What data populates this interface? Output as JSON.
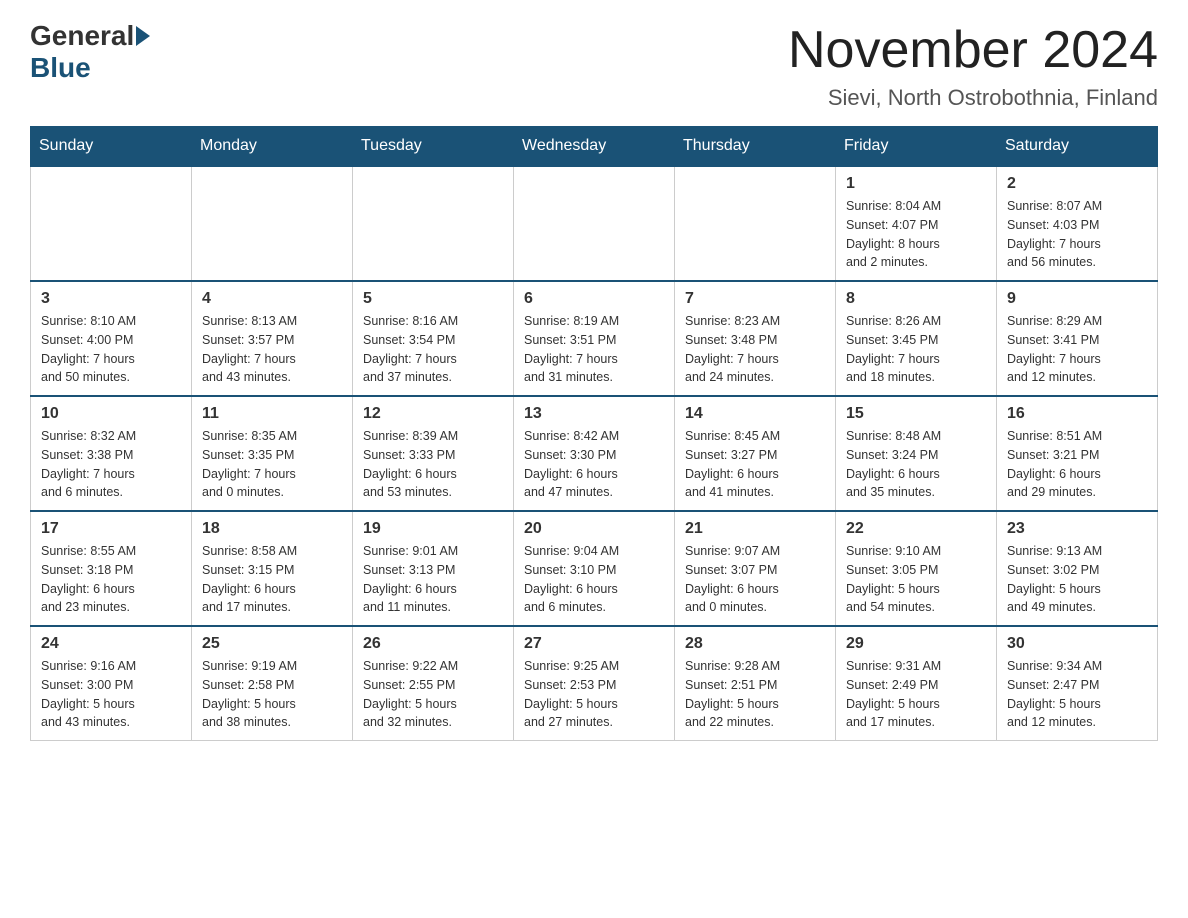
{
  "header": {
    "logo": {
      "general": "General",
      "blue": "Blue"
    },
    "title": "November 2024",
    "location": "Sievi, North Ostrobothnia, Finland"
  },
  "calendar": {
    "days_of_week": [
      "Sunday",
      "Monday",
      "Tuesday",
      "Wednesday",
      "Thursday",
      "Friday",
      "Saturday"
    ],
    "weeks": [
      [
        {
          "day": "",
          "info": ""
        },
        {
          "day": "",
          "info": ""
        },
        {
          "day": "",
          "info": ""
        },
        {
          "day": "",
          "info": ""
        },
        {
          "day": "",
          "info": ""
        },
        {
          "day": "1",
          "info": "Sunrise: 8:04 AM\nSunset: 4:07 PM\nDaylight: 8 hours\nand 2 minutes."
        },
        {
          "day": "2",
          "info": "Sunrise: 8:07 AM\nSunset: 4:03 PM\nDaylight: 7 hours\nand 56 minutes."
        }
      ],
      [
        {
          "day": "3",
          "info": "Sunrise: 8:10 AM\nSunset: 4:00 PM\nDaylight: 7 hours\nand 50 minutes."
        },
        {
          "day": "4",
          "info": "Sunrise: 8:13 AM\nSunset: 3:57 PM\nDaylight: 7 hours\nand 43 minutes."
        },
        {
          "day": "5",
          "info": "Sunrise: 8:16 AM\nSunset: 3:54 PM\nDaylight: 7 hours\nand 37 minutes."
        },
        {
          "day": "6",
          "info": "Sunrise: 8:19 AM\nSunset: 3:51 PM\nDaylight: 7 hours\nand 31 minutes."
        },
        {
          "day": "7",
          "info": "Sunrise: 8:23 AM\nSunset: 3:48 PM\nDaylight: 7 hours\nand 24 minutes."
        },
        {
          "day": "8",
          "info": "Sunrise: 8:26 AM\nSunset: 3:45 PM\nDaylight: 7 hours\nand 18 minutes."
        },
        {
          "day": "9",
          "info": "Sunrise: 8:29 AM\nSunset: 3:41 PM\nDaylight: 7 hours\nand 12 minutes."
        }
      ],
      [
        {
          "day": "10",
          "info": "Sunrise: 8:32 AM\nSunset: 3:38 PM\nDaylight: 7 hours\nand 6 minutes."
        },
        {
          "day": "11",
          "info": "Sunrise: 8:35 AM\nSunset: 3:35 PM\nDaylight: 7 hours\nand 0 minutes."
        },
        {
          "day": "12",
          "info": "Sunrise: 8:39 AM\nSunset: 3:33 PM\nDaylight: 6 hours\nand 53 minutes."
        },
        {
          "day": "13",
          "info": "Sunrise: 8:42 AM\nSunset: 3:30 PM\nDaylight: 6 hours\nand 47 minutes."
        },
        {
          "day": "14",
          "info": "Sunrise: 8:45 AM\nSunset: 3:27 PM\nDaylight: 6 hours\nand 41 minutes."
        },
        {
          "day": "15",
          "info": "Sunrise: 8:48 AM\nSunset: 3:24 PM\nDaylight: 6 hours\nand 35 minutes."
        },
        {
          "day": "16",
          "info": "Sunrise: 8:51 AM\nSunset: 3:21 PM\nDaylight: 6 hours\nand 29 minutes."
        }
      ],
      [
        {
          "day": "17",
          "info": "Sunrise: 8:55 AM\nSunset: 3:18 PM\nDaylight: 6 hours\nand 23 minutes."
        },
        {
          "day": "18",
          "info": "Sunrise: 8:58 AM\nSunset: 3:15 PM\nDaylight: 6 hours\nand 17 minutes."
        },
        {
          "day": "19",
          "info": "Sunrise: 9:01 AM\nSunset: 3:13 PM\nDaylight: 6 hours\nand 11 minutes."
        },
        {
          "day": "20",
          "info": "Sunrise: 9:04 AM\nSunset: 3:10 PM\nDaylight: 6 hours\nand 6 minutes."
        },
        {
          "day": "21",
          "info": "Sunrise: 9:07 AM\nSunset: 3:07 PM\nDaylight: 6 hours\nand 0 minutes."
        },
        {
          "day": "22",
          "info": "Sunrise: 9:10 AM\nSunset: 3:05 PM\nDaylight: 5 hours\nand 54 minutes."
        },
        {
          "day": "23",
          "info": "Sunrise: 9:13 AM\nSunset: 3:02 PM\nDaylight: 5 hours\nand 49 minutes."
        }
      ],
      [
        {
          "day": "24",
          "info": "Sunrise: 9:16 AM\nSunset: 3:00 PM\nDaylight: 5 hours\nand 43 minutes."
        },
        {
          "day": "25",
          "info": "Sunrise: 9:19 AM\nSunset: 2:58 PM\nDaylight: 5 hours\nand 38 minutes."
        },
        {
          "day": "26",
          "info": "Sunrise: 9:22 AM\nSunset: 2:55 PM\nDaylight: 5 hours\nand 32 minutes."
        },
        {
          "day": "27",
          "info": "Sunrise: 9:25 AM\nSunset: 2:53 PM\nDaylight: 5 hours\nand 27 minutes."
        },
        {
          "day": "28",
          "info": "Sunrise: 9:28 AM\nSunset: 2:51 PM\nDaylight: 5 hours\nand 22 minutes."
        },
        {
          "day": "29",
          "info": "Sunrise: 9:31 AM\nSunset: 2:49 PM\nDaylight: 5 hours\nand 17 minutes."
        },
        {
          "day": "30",
          "info": "Sunrise: 9:34 AM\nSunset: 2:47 PM\nDaylight: 5 hours\nand 12 minutes."
        }
      ]
    ]
  }
}
